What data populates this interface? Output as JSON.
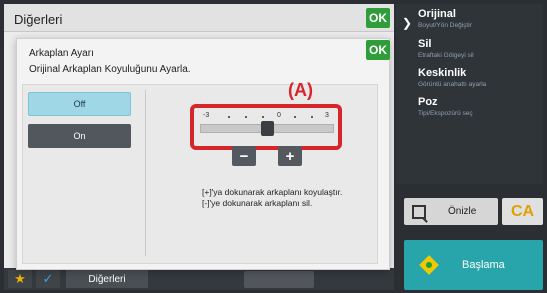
{
  "window": {
    "title": "Diğerleri",
    "ok_label": "OK"
  },
  "menu": {
    "items": [
      {
        "title": "Orijinal",
        "subtitle": "Boyut/Yön Değiştir"
      },
      {
        "title": "Sil",
        "subtitle": "Etraftaki Gölgeyi sil"
      },
      {
        "title": "Keskinlik",
        "subtitle": "Görüntü anahattı ayarla"
      },
      {
        "title": "Poz",
        "subtitle": "Tipi/Ekspozürü seç"
      }
    ]
  },
  "actions": {
    "preview_label": "Önizle",
    "ca_label": "CA",
    "start_label": "Başlama"
  },
  "bottom": {
    "tab_label": "Diğerleri",
    "star_icon": "★",
    "check_icon": "✓"
  },
  "dialog": {
    "title": "Arkaplan Ayarı",
    "subtitle": "Orijinal Arkaplan Koyuluğunu Ayarla.",
    "ok_label": "OK",
    "options": {
      "off": "Off",
      "on": "On",
      "selected": "Off"
    },
    "slider": {
      "min_label": "-3",
      "mid_label": "0",
      "max_label": "3",
      "min": -3,
      "max": 3,
      "value": 0
    },
    "annotation": "(A)",
    "minus_label": "−",
    "plus_label": "+",
    "hint_line1": "[+]'ya dokunarak arkaplanı koyulaştır.",
    "hint_line2": "[-]'ye dokunarak arkaplanı sil."
  },
  "colors": {
    "accent_ok": "#2f9d3a",
    "annotation": "#d6262c",
    "selected_option": "#9fd7e6",
    "start_button": "#28a5aa"
  }
}
